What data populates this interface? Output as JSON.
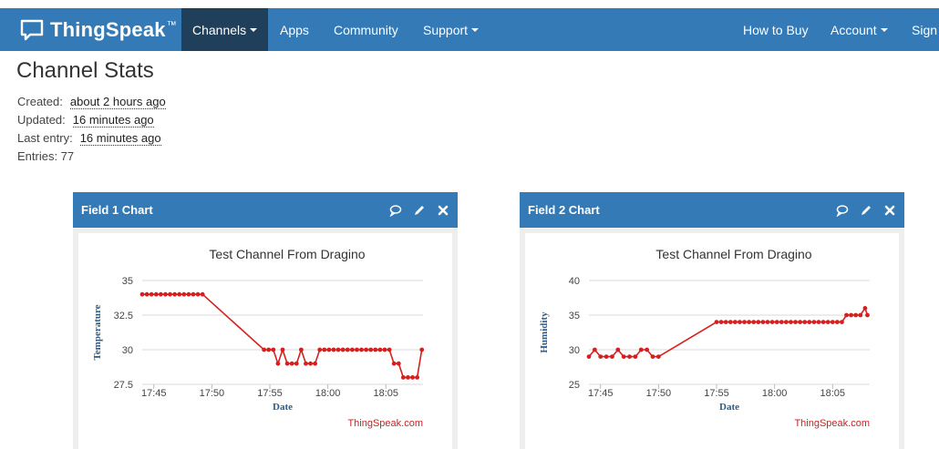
{
  "navbar": {
    "brand": "ThingSpeak",
    "tm": "™",
    "items": [
      {
        "label": "Channels",
        "caret": true
      },
      {
        "label": "Apps",
        "caret": false
      },
      {
        "label": "Community",
        "caret": false
      },
      {
        "label": "Support",
        "caret": true
      },
      {
        "label": "How to Buy",
        "caret": false
      },
      {
        "label": "Account",
        "caret": true
      },
      {
        "label": "Sign",
        "caret": false
      }
    ],
    "colors": {
      "bar": "#337ab7",
      "active": "#1f3f5a"
    }
  },
  "stats": {
    "title": "Channel Stats",
    "created_label": "Created:",
    "created_value": "about 2 hours ago",
    "updated_label": "Updated:",
    "updated_value": "16 minutes ago",
    "last_entry_label": "Last entry:",
    "last_entry_value": "16 minutes ago",
    "entries": "Entries: 77"
  },
  "panels": [
    {
      "title": "Field 1 Chart",
      "icons": [
        "comment-icon",
        "pencil-icon",
        "close-icon"
      ]
    },
    {
      "title": "Field 2 Chart",
      "icons": [
        "comment-icon",
        "pencil-icon",
        "close-icon"
      ]
    }
  ],
  "chart_data": [
    {
      "type": "line",
      "title": "Test Channel From Dragino",
      "xlabel": "Date",
      "ylabel": "Temperature",
      "credit": "ThingSpeak.com",
      "color": "#d62020",
      "x_ticks": [
        {
          "label": "17:45",
          "minute": 45
        },
        {
          "label": "17:50",
          "minute": 50
        },
        {
          "label": "17:55",
          "minute": 55
        },
        {
          "label": "18:00",
          "minute": 60
        },
        {
          "label": "18:05",
          "minute": 65
        }
      ],
      "x_range": [
        44.0,
        68.2
      ],
      "y_ticks": [
        27.5,
        30,
        32.5,
        35
      ],
      "ylim": [
        27.5,
        35
      ],
      "grid": true,
      "series": [
        {
          "x": [
            44.0,
            44.4,
            44.8,
            45.2,
            45.6,
            46.0,
            46.4,
            46.8,
            47.2,
            47.6,
            48.0,
            48.4,
            48.8,
            49.2,
            54.5,
            54.9,
            55.3,
            55.7,
            56.1,
            56.5,
            56.9,
            57.3,
            57.7,
            58.1,
            58.5,
            58.9,
            59.3,
            59.7,
            60.1,
            60.5,
            60.9,
            61.3,
            61.7,
            62.1,
            62.5,
            62.9,
            63.3,
            63.7,
            64.1,
            64.5,
            64.9,
            65.3,
            65.7,
            66.1,
            66.5,
            66.9,
            67.3,
            67.7,
            68.1
          ],
          "y": [
            34,
            34,
            34,
            34,
            34,
            34,
            34,
            34,
            34,
            34,
            34,
            34,
            34,
            34,
            30,
            30,
            30,
            29,
            30,
            29,
            29,
            29,
            30,
            29,
            29,
            29,
            30,
            30,
            30,
            30,
            30,
            30,
            30,
            30,
            30,
            30,
            30,
            30,
            30,
            30,
            30,
            30,
            29,
            29,
            28,
            28,
            28,
            28,
            30
          ]
        }
      ]
    },
    {
      "type": "line",
      "title": "Test Channel From Dragino",
      "xlabel": "Date",
      "ylabel": "Humidity",
      "credit": "ThingSpeak.com",
      "color": "#d62020",
      "x_ticks": [
        {
          "label": "17:45",
          "minute": 45
        },
        {
          "label": "17:50",
          "minute": 50
        },
        {
          "label": "17:55",
          "minute": 55
        },
        {
          "label": "18:00",
          "minute": 60
        },
        {
          "label": "18:05",
          "minute": 65
        }
      ],
      "x_range": [
        44.0,
        68.2
      ],
      "y_ticks": [
        25,
        30,
        35,
        40
      ],
      "ylim": [
        25,
        40
      ],
      "grid": true,
      "series": [
        {
          "x": [
            44.0,
            44.5,
            45.0,
            45.5,
            46.0,
            46.5,
            47.0,
            47.5,
            48.0,
            48.5,
            49.0,
            49.5,
            50.0,
            55.0,
            55.4,
            55.8,
            56.2,
            56.6,
            57.0,
            57.4,
            57.8,
            58.2,
            58.6,
            59.0,
            59.4,
            59.8,
            60.2,
            60.6,
            61.0,
            61.4,
            61.8,
            62.2,
            62.6,
            63.0,
            63.4,
            63.8,
            64.2,
            64.6,
            65.0,
            65.4,
            65.8,
            66.2,
            66.6,
            67.0,
            67.4,
            67.8,
            68.0
          ],
          "y": [
            29,
            30,
            29,
            29,
            29,
            30,
            29,
            29,
            29,
            30,
            30,
            29,
            29,
            34,
            34,
            34,
            34,
            34,
            34,
            34,
            34,
            34,
            34,
            34,
            34,
            34,
            34,
            34,
            34,
            34,
            34,
            34,
            34,
            34,
            34,
            34,
            34,
            34,
            34,
            34,
            34,
            35,
            35,
            35,
            35,
            36,
            35
          ]
        }
      ]
    }
  ]
}
